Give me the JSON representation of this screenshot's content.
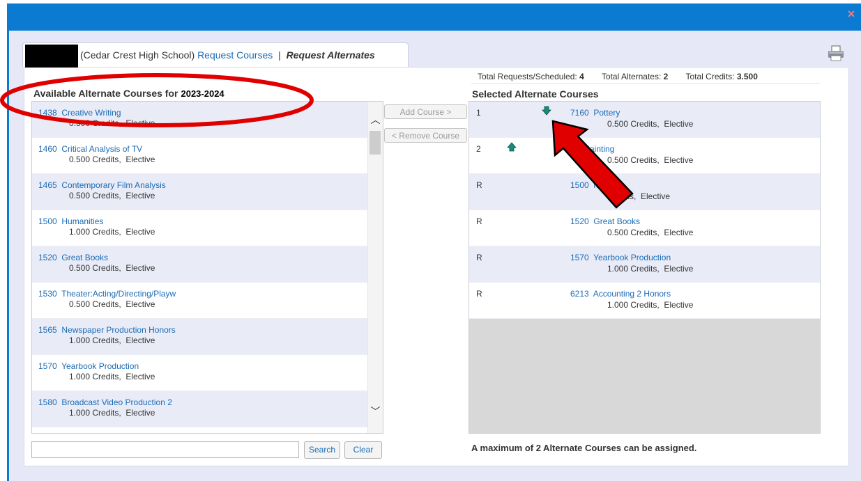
{
  "window": {
    "close_glyph": "✕"
  },
  "tab": {
    "school": "(Cedar Crest High School)",
    "link_request": "Request Courses",
    "separator": "|",
    "current": "Request Alternates"
  },
  "stats": {
    "total_requests_label": "Total Requests/Scheduled:",
    "total_requests_value": "4",
    "total_alternates_label": "Total Alternates:",
    "total_alternates_value": "2",
    "total_credits_label": "Total Credits:",
    "total_credits_value": "3.500"
  },
  "available": {
    "title": "Available Alternate Courses for",
    "year": "2023-2024",
    "items": [
      {
        "code": "1438",
        "name": "Creative Writing",
        "detail": "0.500 Credits,  Elective"
      },
      {
        "code": "1460",
        "name": "Critical Analysis of TV",
        "detail": "0.500 Credits,  Elective"
      },
      {
        "code": "1465",
        "name": "Contemporary Film Analysis",
        "detail": "0.500 Credits,  Elective"
      },
      {
        "code": "1500",
        "name": "Humanities",
        "detail": "1.000 Credits,  Elective"
      },
      {
        "code": "1520",
        "name": "Great Books",
        "detail": "0.500 Credits,  Elective"
      },
      {
        "code": "1530",
        "name": "Theater:Acting/Directing/Playw",
        "detail": "0.500 Credits,  Elective"
      },
      {
        "code": "1565",
        "name": "Newspaper Production Honors",
        "detail": "1.000 Credits,  Elective"
      },
      {
        "code": "1570",
        "name": "Yearbook Production",
        "detail": "1.000 Credits,  Elective"
      },
      {
        "code": "1580",
        "name": "Broadcast Video Production 2",
        "detail": "1.000 Credits,  Elective"
      }
    ]
  },
  "buttons": {
    "add": "Add Course >",
    "remove": "< Remove Course",
    "search": "Search",
    "clear": "Clear"
  },
  "selected": {
    "title": "Selected Alternate Courses",
    "items": [
      {
        "rank": "1",
        "code": "7160",
        "name": "Pottery",
        "detail": "0.500 Credits,  Elective",
        "arrow": "down"
      },
      {
        "rank": "2",
        "code": "",
        "name": "Painting",
        "detail": "0.500 Credits,  Elective",
        "arrow": "up"
      },
      {
        "rank": "R",
        "code": "1500",
        "name": "nities",
        "detail": "Credits,  Elective",
        "arrow": ""
      },
      {
        "rank": "R",
        "code": "1520",
        "name": "Great Books",
        "detail": "0.500 Credits,  Elective",
        "arrow": ""
      },
      {
        "rank": "R",
        "code": "1570",
        "name": "Yearbook Production",
        "detail": "1.000 Credits,  Elective",
        "arrow": ""
      },
      {
        "rank": "R",
        "code": "6213",
        "name": "Accounting 2 Honors",
        "detail": "1.000 Credits,  Elective",
        "arrow": ""
      }
    ]
  },
  "footer_note": "A maximum of 2 Alternate Courses can be assigned.",
  "colors": {
    "header_blue": "#0b7ad1",
    "link_blue": "#1a6bb5",
    "annotation_red": "#e00000",
    "arrow_teal": "#1a8a7a"
  }
}
